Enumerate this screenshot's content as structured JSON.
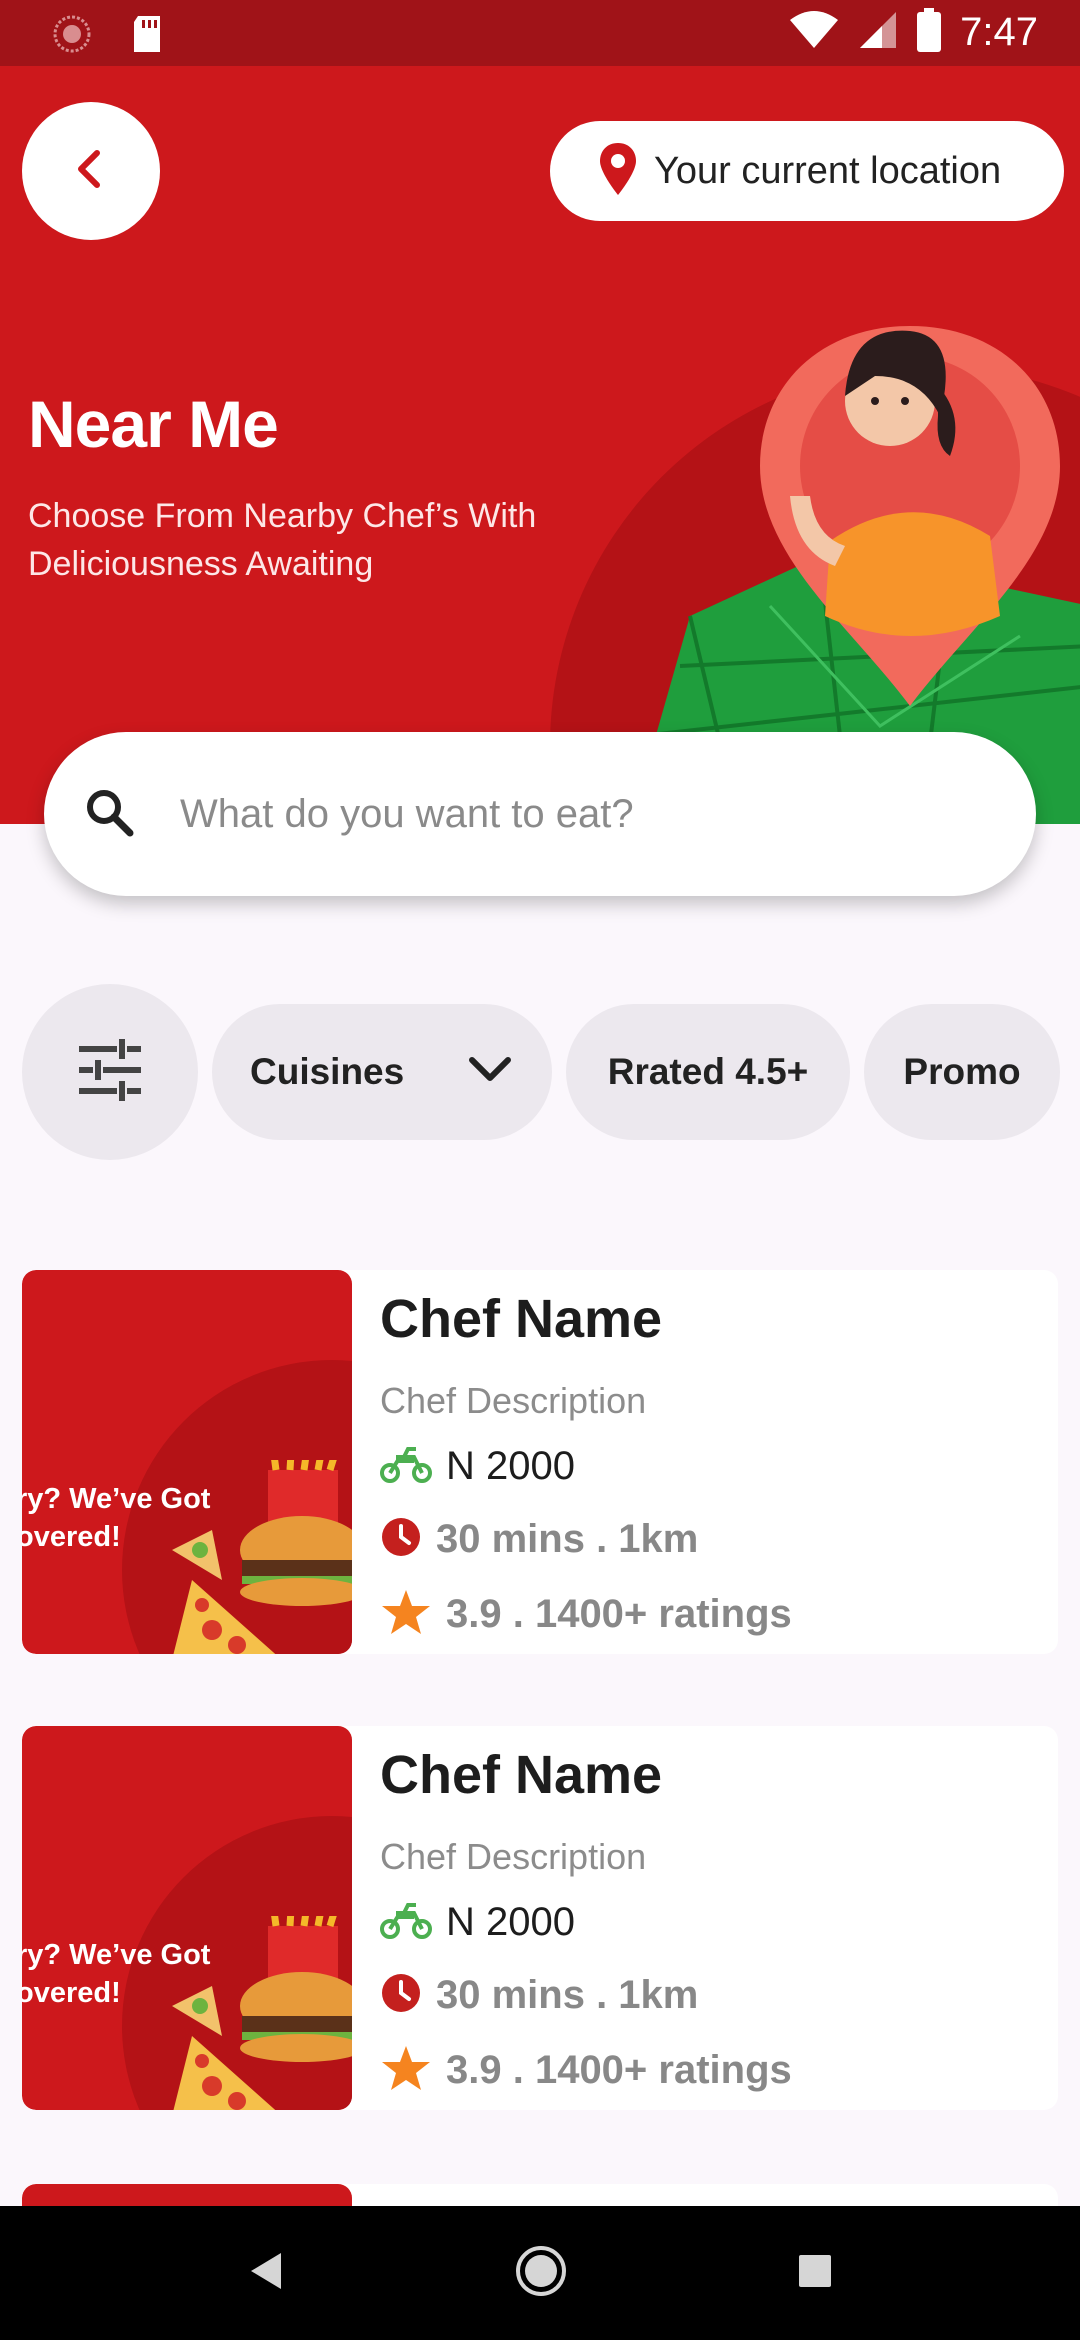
{
  "status_bar": {
    "time": "7:47",
    "icons": [
      "sync-icon",
      "sd-card-icon",
      "wifi-icon",
      "signal-icon",
      "battery-icon"
    ]
  },
  "header": {
    "back_icon": "chevron-left-icon",
    "location_label": "Your current location",
    "location_icon": "map-pin-icon",
    "title": "Near Me",
    "subtitle_line1": "Choose From Nearby Chef’s With",
    "subtitle_line2": "Deliciousness Awaiting"
  },
  "search": {
    "placeholder": "What do you want to eat?",
    "icon": "search-icon"
  },
  "filters": {
    "filter_icon": "sliders-icon",
    "chips": [
      {
        "label": "Cuisines",
        "icon": "chevron-down-icon"
      },
      {
        "label": "Rrated 4.5+"
      },
      {
        "label": "Promo"
      }
    ]
  },
  "chefs": [
    {
      "name": "Chef Name",
      "description": "Chef Description",
      "price": "N 2000",
      "time_distance": "30 mins . 1km",
      "rating": "3.9 . 1400+ ratings",
      "image_text_line1": "ry? We’ve Got",
      "image_text_line2": "overed!"
    },
    {
      "name": "Chef Name",
      "description": "Chef Description",
      "price": "N 2000",
      "time_distance": "30 mins . 1km",
      "rating": "3.9 . 1400+ ratings",
      "image_text_line1": "ry? We’ve Got",
      "image_text_line2": "overed!"
    }
  ],
  "colors": {
    "primary": "#cd181c",
    "primary_dark": "#a01318",
    "chip_bg": "#ece8ee",
    "bike_green": "#4caf50",
    "star_orange": "#f5841f",
    "clock_red": "#c4201e"
  },
  "nav": {
    "icons": [
      "back-nav-icon",
      "home-nav-icon",
      "recents-nav-icon"
    ]
  }
}
